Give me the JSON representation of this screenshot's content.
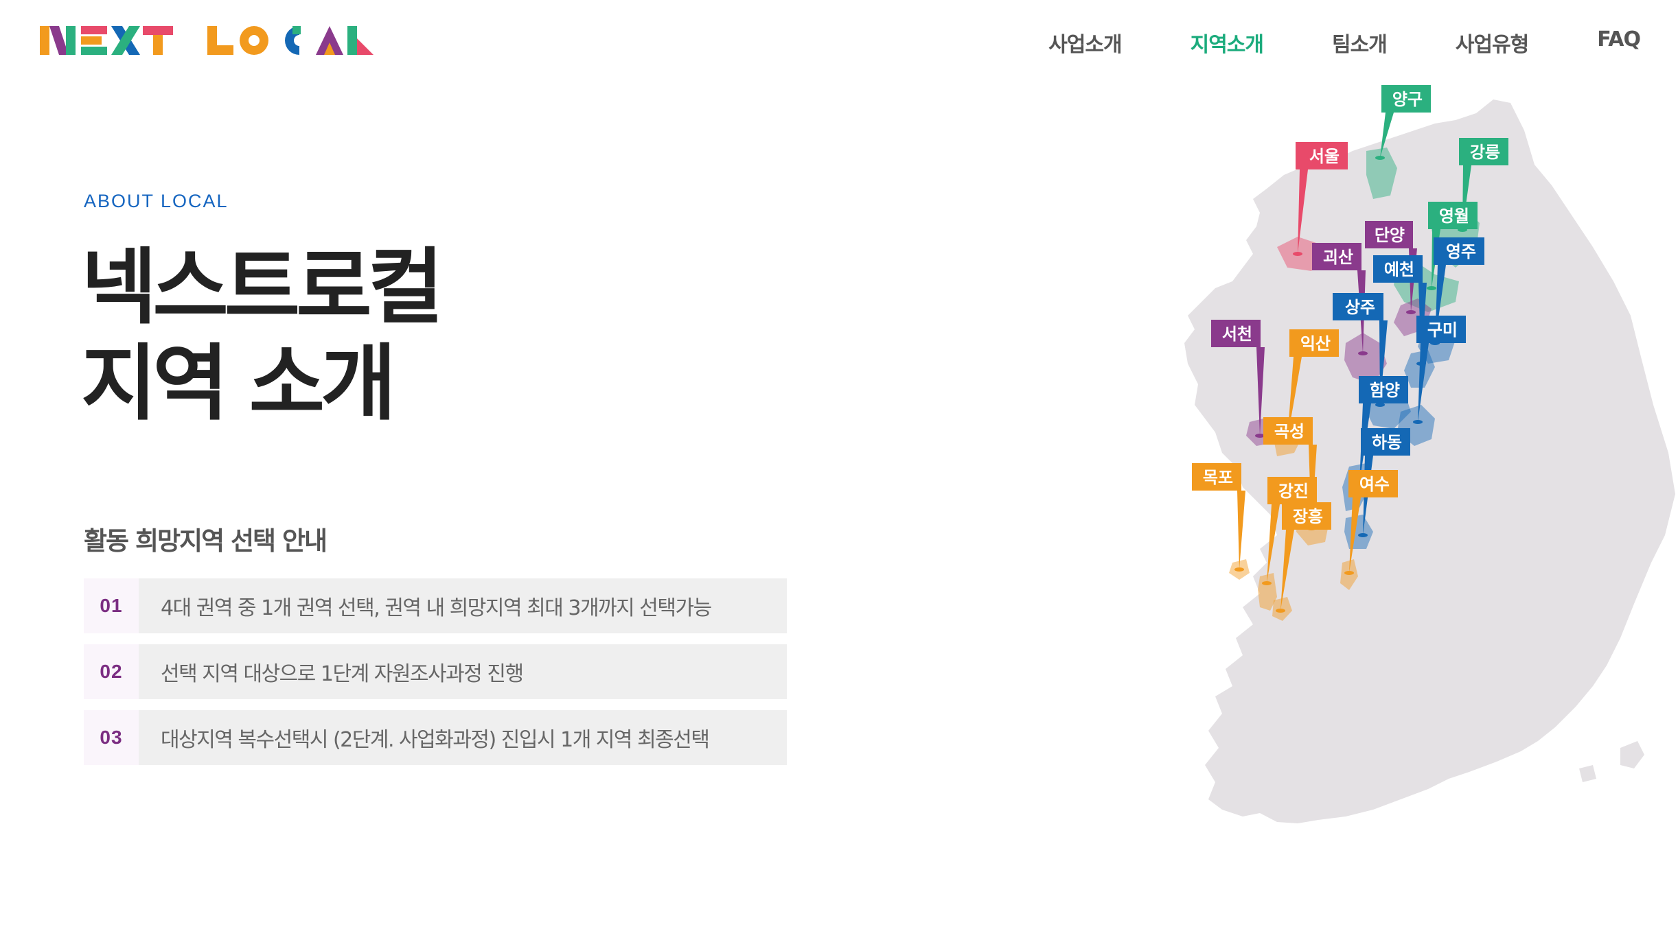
{
  "header": {
    "logo_text": "NEXT LOCAL",
    "nav": [
      {
        "label": "사업소개",
        "active": false
      },
      {
        "label": "지역소개",
        "active": true
      },
      {
        "label": "팀소개",
        "active": false
      },
      {
        "label": "사업유형",
        "active": false
      },
      {
        "label": "FAQ",
        "active": false
      }
    ]
  },
  "hero": {
    "eyebrow": "ABOUT LOCAL",
    "title_line1": "넥스트로컬",
    "title_line2": "지역 소개"
  },
  "guide": {
    "heading": "활동 희망지역 선택 안내",
    "steps": [
      {
        "num": "01",
        "text": "4대 권역 중 1개 권역 선택, 권역 내 희망지역 최대 3개까지 선택가능"
      },
      {
        "num": "02",
        "text": "선택 지역 대상으로 1단계 자원조사과정 진행"
      },
      {
        "num": "03",
        "text": "대상지역 복수선택시 (2단계. 사업화과정) 진입시 1개 지역 최종선택"
      }
    ]
  },
  "map": {
    "colors": {
      "green": "#2bb07f",
      "pink": "#e84a6a",
      "purple": "#8a3a8c",
      "blue": "#1468b5",
      "orange": "#f29a1e",
      "land": "#e4e1e4"
    },
    "regions": [
      {
        "name": "양구",
        "color": "green"
      },
      {
        "name": "서울",
        "color": "pink"
      },
      {
        "name": "강릉",
        "color": "green"
      },
      {
        "name": "영월",
        "color": "green"
      },
      {
        "name": "단양",
        "color": "purple"
      },
      {
        "name": "괴산",
        "color": "purple"
      },
      {
        "name": "영주",
        "color": "blue"
      },
      {
        "name": "예천",
        "color": "blue"
      },
      {
        "name": "상주",
        "color": "blue"
      },
      {
        "name": "구미",
        "color": "blue"
      },
      {
        "name": "서천",
        "color": "purple"
      },
      {
        "name": "익산",
        "color": "orange"
      },
      {
        "name": "함양",
        "color": "blue"
      },
      {
        "name": "곡성",
        "color": "orange"
      },
      {
        "name": "하동",
        "color": "blue"
      },
      {
        "name": "목포",
        "color": "orange"
      },
      {
        "name": "강진",
        "color": "orange"
      },
      {
        "name": "여수",
        "color": "orange"
      },
      {
        "name": "장흥",
        "color": "orange"
      }
    ]
  }
}
